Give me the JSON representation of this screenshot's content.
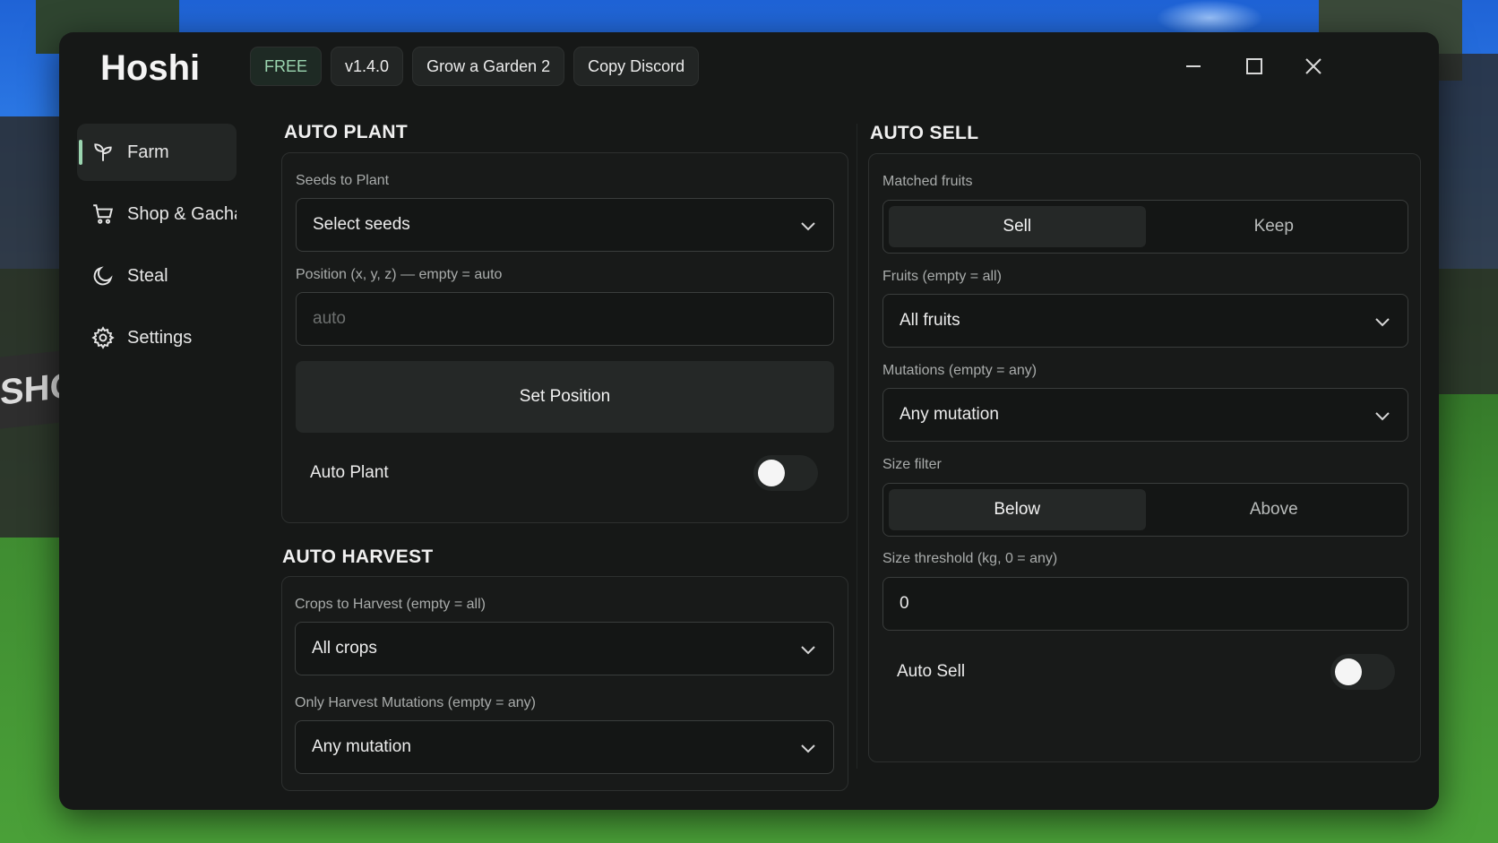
{
  "app": {
    "title": "Hoshi",
    "chips": [
      "FREE",
      "v1.4.0",
      "Grow a Garden 2",
      "Copy Discord"
    ]
  },
  "background": {
    "sign_text": "SHOP"
  },
  "sidebar": {
    "items": [
      {
        "label": "Farm",
        "icon": "sprout-icon",
        "active": true
      },
      {
        "label": "Shop & Gacha",
        "icon": "cart-icon",
        "active": false
      },
      {
        "label": "Steal",
        "icon": "moon-icon",
        "active": false
      },
      {
        "label": "Settings",
        "icon": "gear-icon",
        "active": false
      }
    ]
  },
  "auto_plant": {
    "title": "AUTO PLANT",
    "seeds_label": "Seeds to Plant",
    "seeds_value": "Select seeds",
    "position_label": "Position (x, y, z) — empty = auto",
    "position_placeholder": "auto",
    "set_position_label": "Set Position",
    "toggle_label": "Auto Plant",
    "toggle_on": false
  },
  "auto_harvest": {
    "title": "AUTO HARVEST",
    "crops_label": "Crops to Harvest (empty = all)",
    "crops_value": "All crops",
    "mutations_label": "Only Harvest Mutations (empty = any)",
    "mutations_value": "Any mutation"
  },
  "auto_sell": {
    "title": "AUTO SELL",
    "matched_label": "Matched fruits",
    "matched_options": [
      "Sell",
      "Keep"
    ],
    "matched_selected": "Sell",
    "fruits_label": "Fruits (empty = all)",
    "fruits_value": "All fruits",
    "mutations_label": "Mutations (empty = any)",
    "mutations_value": "Any mutation",
    "size_filter_label": "Size filter",
    "size_filter_options": [
      "Below",
      "Above"
    ],
    "size_filter_selected": "Below",
    "size_threshold_label": "Size threshold (kg, 0 = any)",
    "size_threshold_value": "0",
    "toggle_label": "Auto Sell",
    "toggle_on": false
  },
  "colors": {
    "accent": "#9bd5b0",
    "window_bg": "#161817",
    "panel_bg": "#181a19"
  }
}
